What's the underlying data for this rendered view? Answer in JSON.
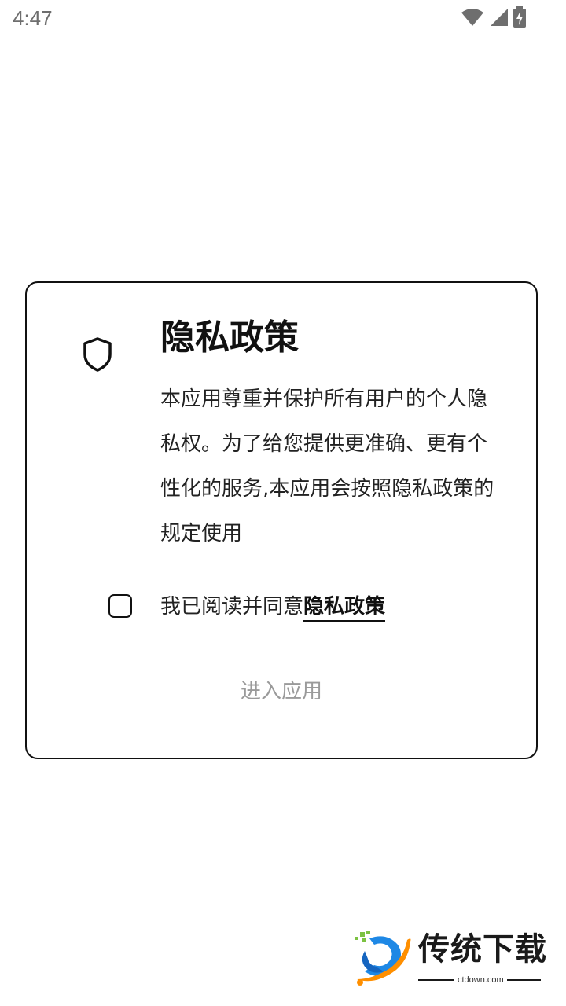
{
  "status_bar": {
    "time": "4:47",
    "icons": [
      "wifi-icon",
      "cell-signal-icon",
      "battery-charging-icon"
    ]
  },
  "dialog": {
    "icon": "shield-icon",
    "title": "隐私政策",
    "body": "本应用尊重并保护所有用户的个人隐私权。为了给您提供更准确、更有个性化的服务,本应用会按照隐私政策的规定使用",
    "consent": {
      "checked": false,
      "text": "我已阅读并同意",
      "link_text": "隐私政策"
    },
    "enter_button": "进入应用"
  },
  "watermark": {
    "name": "传统下载",
    "domain": "ctdown.com"
  },
  "colors": {
    "text": "#111111",
    "muted": "#9a9a9a",
    "border": "#111111",
    "background": "#ffffff",
    "watermark_blue": "#1e88e5",
    "watermark_orange": "#ff8f00",
    "watermark_green": "#7cc242"
  }
}
